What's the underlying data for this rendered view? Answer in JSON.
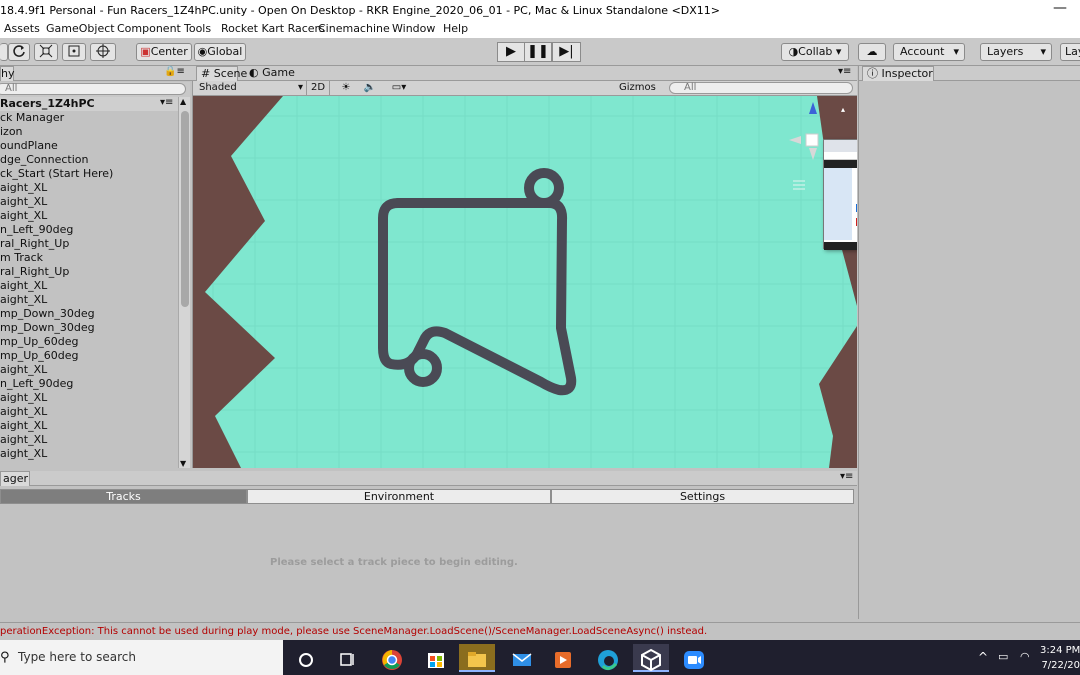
{
  "window": {
    "title": "18.4.9f1 Personal - Fun Racers_1Z4hPC.unity - Open On Desktop - RKR Engine_2020_06_01 - PC, Mac & Linux Standalone <DX11>",
    "minimize_glyph": "—"
  },
  "menu": [
    "Assets",
    "GameObject",
    "Component",
    "Tools",
    "Rocket Kart Racers",
    "Cinemachine",
    "Window",
    "Help"
  ],
  "toolbar": {
    "pivot_label": "Center",
    "space_label": "Global",
    "collab_label": "Collab ▾",
    "account_label": "Account",
    "layers_label": "Layers",
    "layout_label": "Lay"
  },
  "hierarchy": {
    "tab_label": "hy",
    "search_placeholder": "All",
    "scene_name": "Racers_1Z4hPC",
    "items": [
      "ck Manager",
      "izon",
      "oundPlane",
      "dge_Connection",
      "ck_Start (Start Here)",
      "aight_XL",
      "aight_XL",
      "aight_XL",
      "n_Left_90deg",
      "ral_Right_Up",
      "m Track",
      "ral_Right_Up",
      "aight_XL",
      "aight_XL",
      "mp_Down_30deg",
      "mp_Down_30deg",
      "mp_Up_60deg",
      "mp_Up_60deg",
      "aight_XL",
      "n_Left_90deg",
      "aight_XL",
      "aight_XL",
      "aight_XL",
      "aight_XL",
      "aight_XL"
    ]
  },
  "scene": {
    "tab_scene": "Scene",
    "tab_game": "Game",
    "shading_mode": "Shaded",
    "mode_2d": "2D",
    "gizmos_label": "Gizmos",
    "search_placeholder": "All",
    "ground_color": "#7fe7cf",
    "terrain_color": "#6b4a45",
    "track_color": "#4a4a55"
  },
  "inspector": {
    "tab_label": "Inspector"
  },
  "track_manager": {
    "tab_label": "ager",
    "tabs": [
      "Tracks",
      "Environment",
      "Settings"
    ],
    "active_tab": "Tracks",
    "empty_message": "Please select a track piece to begin editing."
  },
  "console": {
    "error_text": "perationException: This cannot be used during play mode, please use SceneManager.LoadScene()/SceneManager.LoadSceneAsync() instead."
  },
  "taskbar": {
    "search_placeholder": "Type here to search",
    "time": "3:24 PM",
    "date": "7/22/20"
  }
}
